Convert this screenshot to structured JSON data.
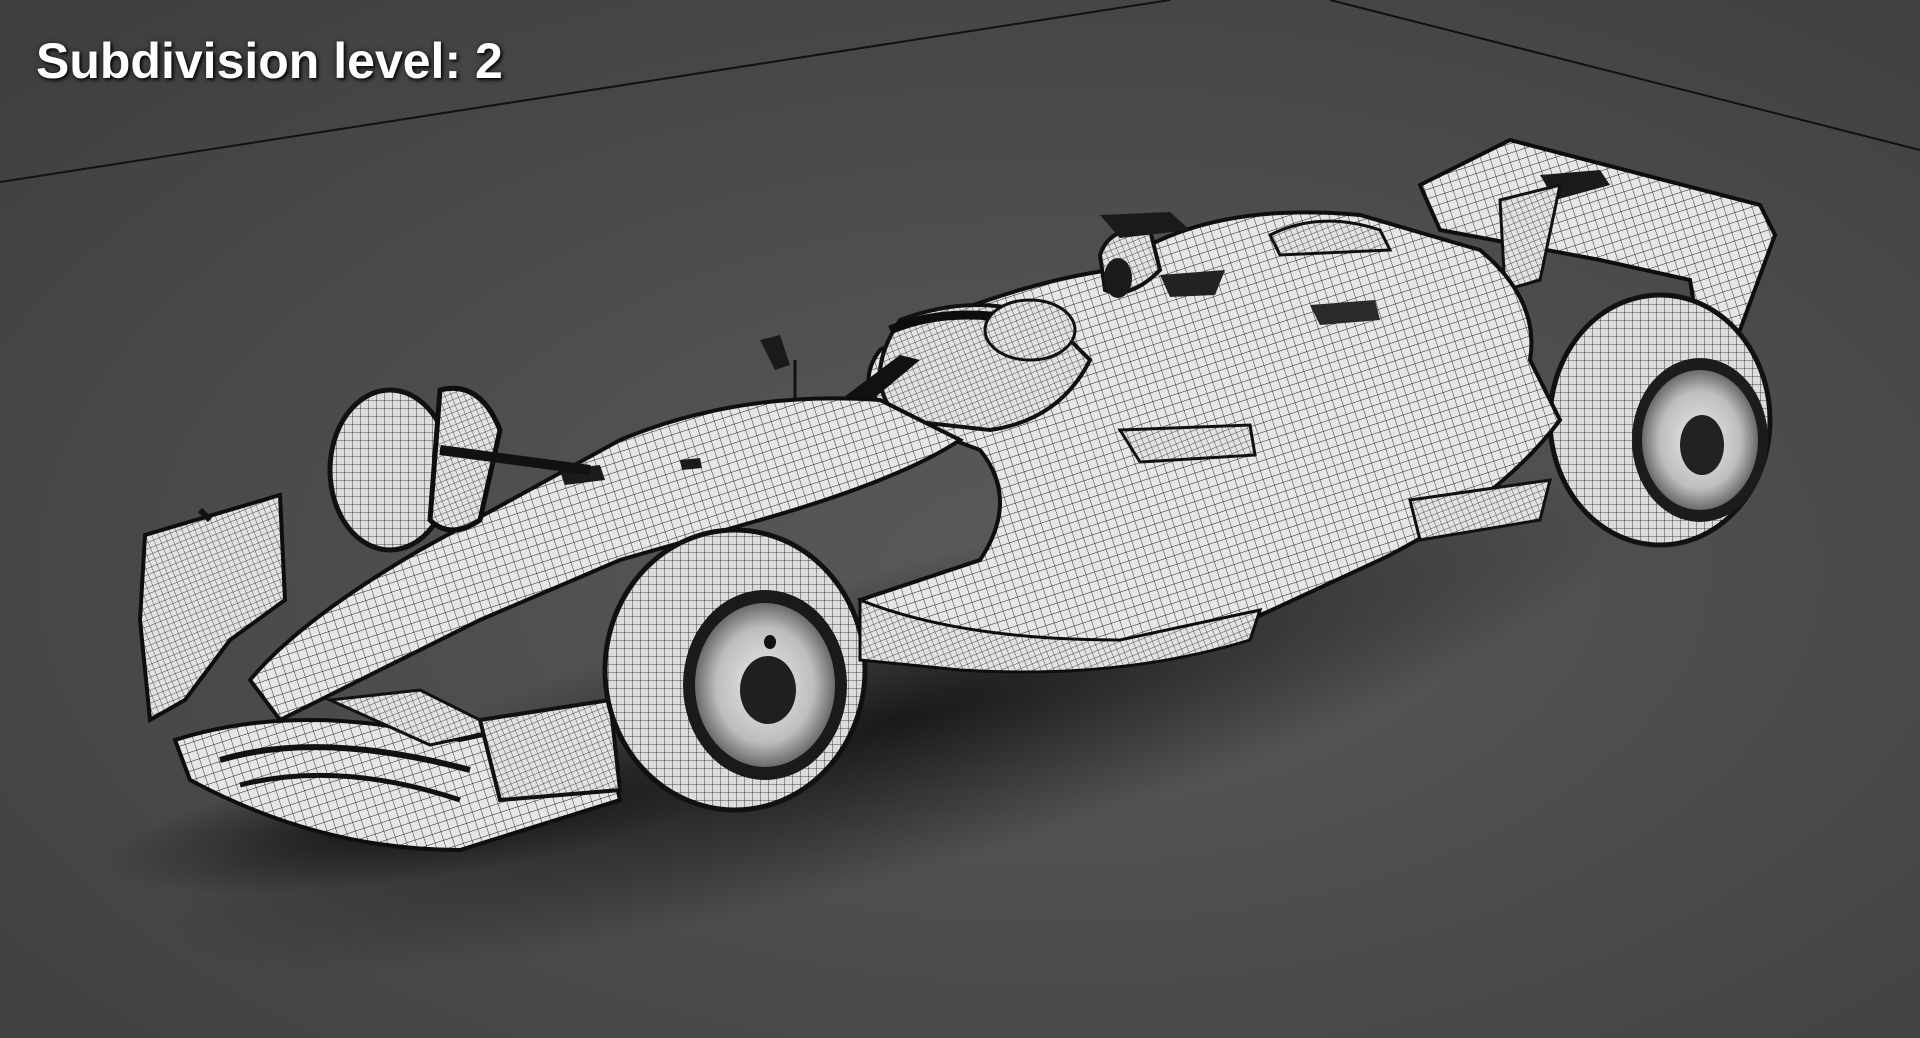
{
  "viewport": {
    "label": "Subdivision level: 2",
    "subject": "wireframe-race-car",
    "colors": {
      "floor": "#4b4b4b",
      "mesh_surface": "#e9e9e9",
      "mesh_lines": "#1a1a1a",
      "overlay_text": "#ffffff"
    }
  }
}
